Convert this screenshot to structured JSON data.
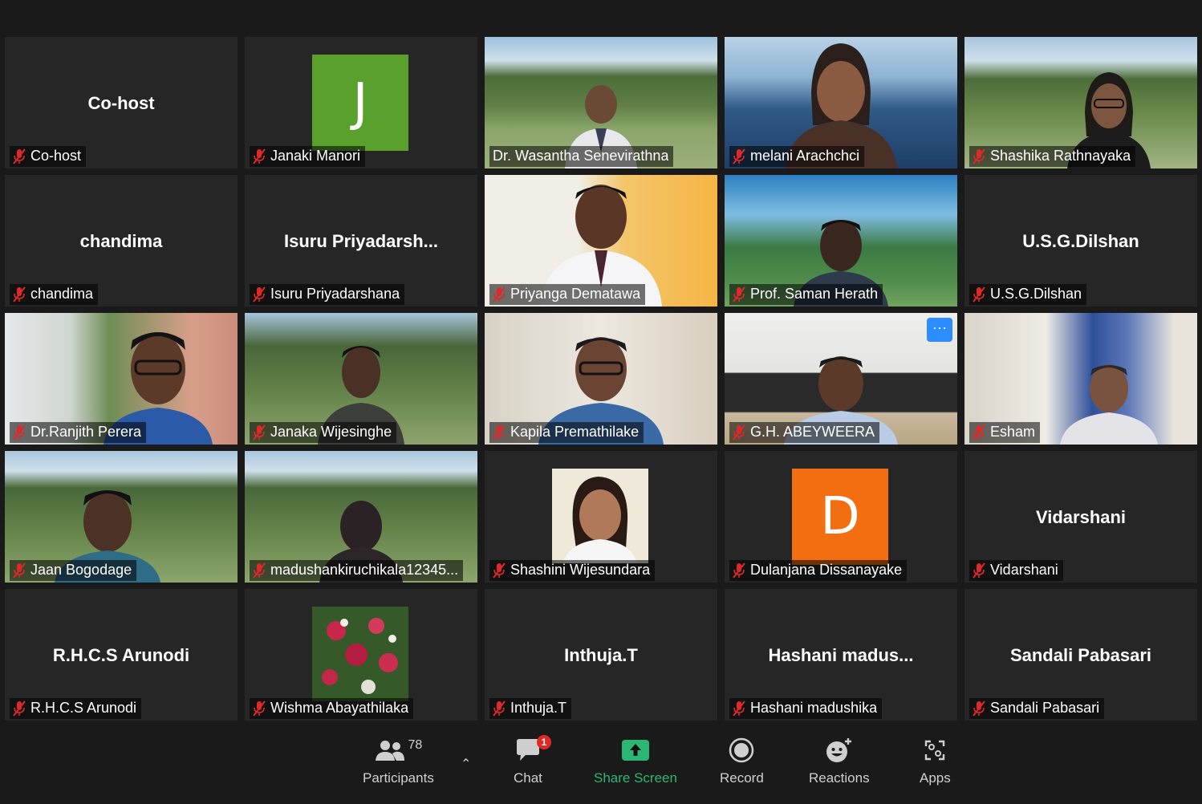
{
  "participants": [
    {
      "display": "Co-host",
      "name": "Co-host"
    },
    {
      "name": "Janaki Manori",
      "avatar_letter": "J",
      "avatar_color": "#5aa02c"
    },
    {
      "name": "Dr. Wasantha Senevirathna"
    },
    {
      "name": "melani Arachchci"
    },
    {
      "name": "Shashika Rathnayaka"
    },
    {
      "display": "chandima",
      "name": "chandima"
    },
    {
      "display": "Isuru  Priyadarsh...",
      "name": "Isuru Priyadarshana"
    },
    {
      "name": "Priyanga Dematawa"
    },
    {
      "name": "Prof. Saman Herath"
    },
    {
      "display": "U.S.G.Dilshan",
      "name": "U.S.G.Dilshan"
    },
    {
      "name": "Dr.Ranjith Perera"
    },
    {
      "name": "Janaka Wijesinghe"
    },
    {
      "name": "Kapila Premathilake"
    },
    {
      "name": "G.H. ABEYWEERA",
      "more_button": "···"
    },
    {
      "name": "Esham"
    },
    {
      "name": "Jaan Bogodage"
    },
    {
      "name": "madushankiruchikala12345..."
    },
    {
      "name": "Shashini Wijesundara"
    },
    {
      "name": "Dulanjana Dissanayake",
      "avatar_letter": "D",
      "avatar_color": "#f26e11"
    },
    {
      "display": "Vidarshani",
      "name": "Vidarshani"
    },
    {
      "display": "R.H.C.S Arunodi",
      "name": "R.H.C.S Arunodi"
    },
    {
      "name": "Wishma Abayathilaka"
    },
    {
      "display": "Inthuja.T",
      "name": "Inthuja.T"
    },
    {
      "display": "Hashani  madus...",
      "name": "Hashani madushika"
    },
    {
      "display": "Sandali Pabasari",
      "name": "Sandali Pabasari"
    }
  ],
  "toolbar": {
    "participants_label": "Participants",
    "participants_count": "78",
    "chat_label": "Chat",
    "chat_badge": "1",
    "share_label": "Share Screen",
    "record_label": "Record",
    "reactions_label": "Reactions",
    "apps_label": "Apps"
  },
  "colors": {
    "background": "#1a1a1a",
    "tile": "#262626",
    "active_speaker": "#e7e54c",
    "share": "#2bb673",
    "muted_icon": "#e02828"
  }
}
